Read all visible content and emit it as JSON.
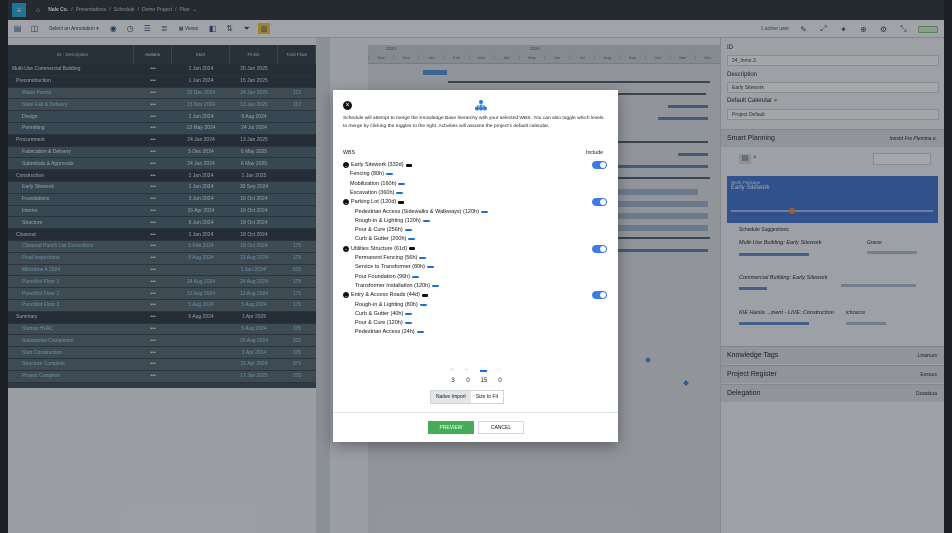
{
  "header": {
    "breadcrumbs": [
      "Nale Co.",
      "/",
      "Presentations",
      "/",
      "Schedule",
      "/",
      "Demo Project",
      "/",
      "Plan"
    ],
    "home_icon": "home-icon"
  },
  "toolbar": {
    "annotation_label": "Select an Annotation",
    "views_label": "Views",
    "active_user": "1 active user"
  },
  "grid": {
    "columns": [
      "ID - Description",
      "Actions",
      "Start",
      "Finish",
      "Total Float"
    ],
    "rows": [
      {
        "type": "group",
        "desc": "Multi-Use Commercial Building",
        "act": "•••",
        "start": "1 Jan 2024",
        "fin": "20 Jun 2025",
        "float": ""
      },
      {
        "type": "group",
        "desc": "Preconstruction",
        "act": "•••",
        "start": "1 Jan 2024",
        "fin": "15 Jan 2025",
        "float": ""
      },
      {
        "type": "task",
        "desc": "Water Permit",
        "act": "•••",
        "start": "25 Dec 2024",
        "fin": "24 Jan 2025",
        "float": "112"
      },
      {
        "type": "task",
        "desc": "Steel Fab & Delivery",
        "act": "•••",
        "start": "13 Nov 2024",
        "fin": "13 Jan 2025",
        "float": "112"
      },
      {
        "type": "sub",
        "desc": "Design",
        "act": "•••",
        "start": "1 Jan 2024",
        "fin": "9 Aug 2024",
        "float": ""
      },
      {
        "type": "sub",
        "desc": "Permitting",
        "act": "•••",
        "start": "13 May 2024",
        "fin": "24 Jul 2024",
        "float": ""
      },
      {
        "type": "group",
        "desc": "Procurement",
        "act": "•••",
        "start": "24 Jun 2024",
        "fin": "13 Jan 2025",
        "float": ""
      },
      {
        "type": "sub",
        "desc": "Fabrication & Delivery",
        "act": "•••",
        "start": "5 Dec 2024",
        "fin": "6 May 2025",
        "float": ""
      },
      {
        "type": "sub",
        "desc": "Submittals & Approvals",
        "act": "•••",
        "start": "24 Jun 2024",
        "fin": "6 May 2025",
        "float": ""
      },
      {
        "type": "group",
        "desc": "Construction",
        "act": "•••",
        "start": "1 Jan 2024",
        "fin": "1 Jan 2025",
        "float": ""
      },
      {
        "type": "sub",
        "desc": "Early Sitework",
        "act": "•••",
        "start": "1 Jan 2024",
        "fin": "30 Sep 2024",
        "float": ""
      },
      {
        "type": "sub",
        "desc": "Foundations",
        "act": "•••",
        "start": "3 Jun 2024",
        "fin": "16 Oct 2024",
        "float": ""
      },
      {
        "type": "sub",
        "desc": "Interior",
        "act": "•••",
        "start": "15 Apr 2024",
        "fin": "16 Oct 2024",
        "float": ""
      },
      {
        "type": "sub",
        "desc": "Structure",
        "act": "•••",
        "start": "5 Jun 2024",
        "fin": "18 Oct 2024",
        "float": ""
      },
      {
        "type": "group",
        "desc": "Closeout",
        "act": "•••",
        "start": "1 Jan 2024",
        "fin": "18 Oct 2024",
        "float": ""
      },
      {
        "type": "task",
        "desc": "Closeout Punch List Corrections",
        "act": "•••",
        "start": "5 Feb 2024",
        "fin": "18 Oct 2024",
        "float": "175"
      },
      {
        "type": "task",
        "desc": "Final Inspections",
        "act": "•••",
        "start": "5 Aug 2024",
        "fin": "13 Aug 2024",
        "float": "175"
      },
      {
        "type": "task",
        "desc": "Milestone A 2024",
        "act": "•••",
        "start": "",
        "fin": "1 Jan 2024*",
        "float": "515"
      },
      {
        "type": "task",
        "desc": "Punchlist Floor 1",
        "act": "•••",
        "start": "24 Aug 2024",
        "fin": "24 Aug 2024",
        "float": "175"
      },
      {
        "type": "task",
        "desc": "Punchlist Floor 2",
        "act": "•••",
        "start": "13 Aug 2024",
        "fin": "13 Aug 2024",
        "float": "175"
      },
      {
        "type": "task",
        "desc": "Punchlist Floor 3",
        "act": "•••",
        "start": "5 Aug 2024",
        "fin": "5 Aug 2024",
        "float": "175"
      },
      {
        "type": "group",
        "desc": "Summary",
        "act": "•••",
        "start": "5 Aug 2024",
        "fin": "1 Apr 2025",
        "float": ""
      },
      {
        "type": "task",
        "desc": "Startup HVAC",
        "act": "•••",
        "start": "",
        "fin": "5 Aug 2024",
        "float": "325"
      },
      {
        "type": "task",
        "desc": "Substantial Completion",
        "act": "•••",
        "start": "",
        "fin": "26 Aug 2024",
        "float": "325"
      },
      {
        "type": "task",
        "desc": "Start Construction",
        "act": "•••",
        "start": "",
        "fin": "1 Apr 2024",
        "float": "325"
      },
      {
        "type": "task",
        "desc": "Structure Complete",
        "act": "•••",
        "start": "",
        "fin": "15 Apr 2024",
        "float": "375"
      },
      {
        "type": "task",
        "desc": "Project Complete",
        "act": "•••",
        "start": "",
        "fin": "17 Jan 2025",
        "float": "375"
      }
    ]
  },
  "timeline": {
    "year_left": "2023",
    "year_right": "2024",
    "months": [
      "Nov",
      "Dec",
      "Jan",
      "Feb",
      "Mar",
      "Apr",
      "May",
      "Jun",
      "Jul",
      "Aug",
      "Sep",
      "Oct",
      "Nov",
      "Dec"
    ]
  },
  "panel": {
    "id_label": "ID",
    "id_value": "24_Inmo.3.",
    "description_label": "Description",
    "description_value": "Early Sitework",
    "calendar_label": "Default Calendar",
    "calendar_value": "Project Default",
    "smart_planning": "Smart Planning",
    "smart_planning_right": "Innsbt Fre Plemina e.",
    "work_package_label": "Work Package",
    "work_package_value": "Early Sitework",
    "schedule_suggestions": "Schedule Suggestions",
    "suggestions": [
      {
        "bold": "Multi-Use Building:",
        "rest": " Early Sitework",
        "right": "Gnexe"
      },
      {
        "bold": "Commercial Building:",
        "rest": " Early Sitework",
        "right": ""
      },
      {
        "bold": "KIE Haisla ...ment - LIVE:",
        "rest": " Construction",
        "right": "ichzacss"
      }
    ],
    "sections": [
      {
        "label": "Knowledge Tags",
        "right": "Lmanurs"
      },
      {
        "label": "Project Register",
        "right": "Ezeaux"
      },
      {
        "label": "Delegation",
        "right": "Dzaatsua"
      }
    ]
  },
  "modal": {
    "description": "Schedule will attempt to merge the Knowledge Base hierarchy with your selected WBS. You can also toggle which levels to merge by clicking the toggles to the right. Activities will assume the project's default calendar.",
    "wbs_label": "WBS",
    "include_label": "Include",
    "groups": [
      {
        "title": "Early Sitework (332d)",
        "items": [
          "Fencing (80h)",
          "Mobilization (160h)",
          "Excavation (360h)"
        ]
      },
      {
        "title": "Parking Lot (120d)",
        "items": [
          "Pedestrian Access (Sidewalks & Walkways) (120h)",
          "Rough-in & Lighting (120h)",
          "Pour & Cure (256h)",
          "Curb & Gutter (200h)"
        ]
      },
      {
        "title": "Utilities Structure (61d)",
        "items": [
          "Permanent Fencing (56h)",
          "Service to Transformer (80h)",
          "Pour Foundation (96h)",
          "Transformer Installation (120h)"
        ]
      },
      {
        "title": "Entry & Access Roads (44d)",
        "items": [
          "Rough-in & Lighting (80h)",
          "Curb & Gutter (40h)",
          "Pour & Cure (120h)",
          "Pedestrian Access (24h)"
        ]
      }
    ],
    "stats": [
      "3",
      "0",
      "15",
      "0"
    ],
    "seg_native": "Native Import",
    "seg_size": "Size to Fit",
    "preview": "PREVIEW",
    "cancel": "CANCEL"
  }
}
